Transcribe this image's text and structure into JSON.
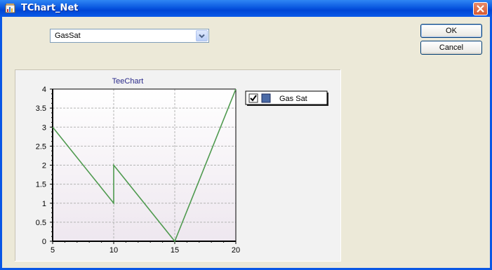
{
  "window": {
    "title": "TChart_Net"
  },
  "combo": {
    "value": "GasSat"
  },
  "buttons": {
    "ok": "OK",
    "cancel": "Cancel"
  },
  "chart_data": {
    "type": "line",
    "title": "TeeChart",
    "xlabel": "",
    "ylabel": "",
    "xlim": [
      5,
      20
    ],
    "ylim": [
      0,
      4
    ],
    "x_ticks": [
      "5",
      "10",
      "15",
      "20"
    ],
    "y_ticks": [
      "0",
      "0.5",
      "1",
      "1.5",
      "2",
      "2.5",
      "3",
      "3.5",
      "4"
    ],
    "grid": true,
    "legend_position": "right",
    "legend_checked": true,
    "series": [
      {
        "name": "Gas Sat",
        "color": "#4f9a4f",
        "swatch_color": "#4a6aa6",
        "points": [
          [
            5,
            3
          ],
          [
            10,
            1
          ],
          [
            10,
            2
          ],
          [
            15,
            0
          ],
          [
            20,
            4
          ]
        ]
      }
    ]
  }
}
